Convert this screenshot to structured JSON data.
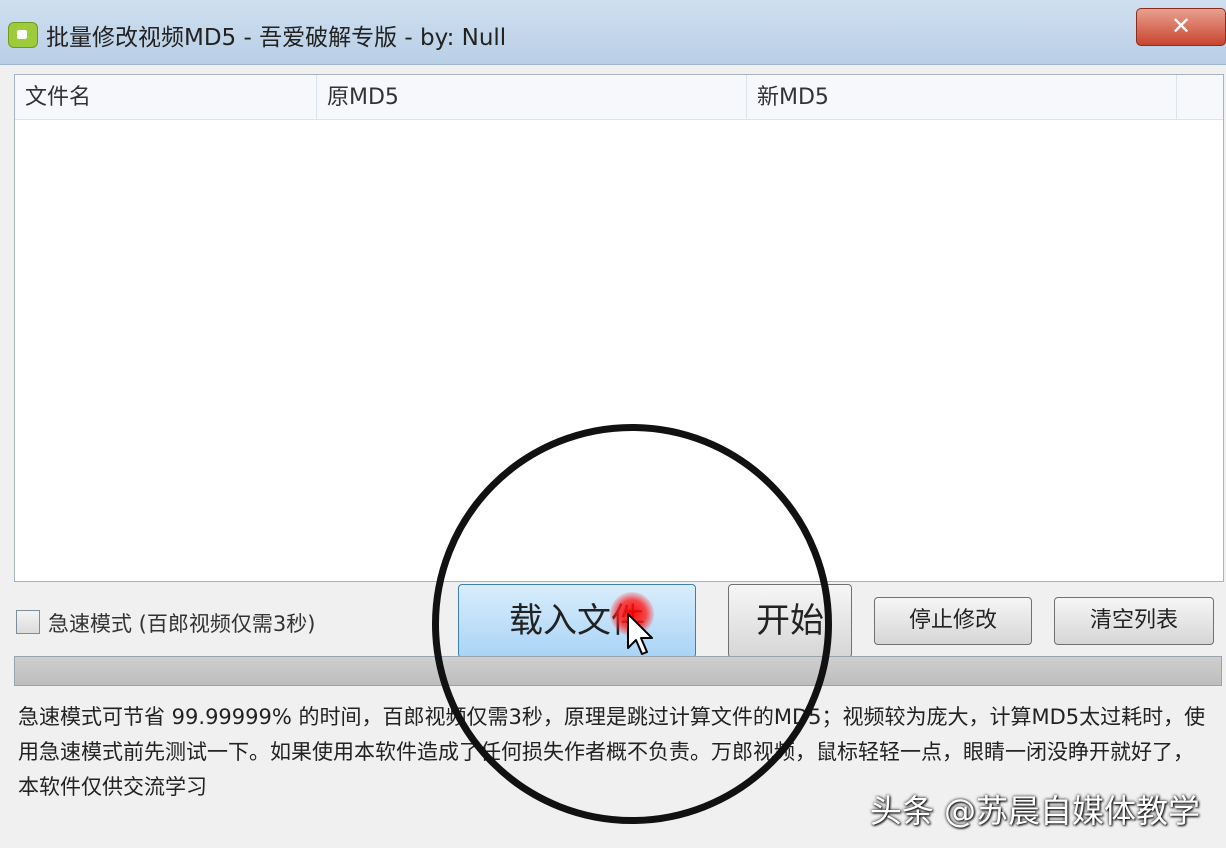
{
  "window": {
    "title": "批量修改视频MD5 - 吾爱破解专版 - by: Null",
    "close_label": "✕"
  },
  "list": {
    "columns": [
      "文件名",
      "原MD5",
      "新MD5"
    ],
    "rows": []
  },
  "options": {
    "fast_mode_label": "急速模式 (百郎视频仅需3秒)",
    "fast_mode_checked": false
  },
  "buttons": {
    "load": "载入文件",
    "start": "开始",
    "stop": "停止修改",
    "clear": "清空列表"
  },
  "progress": {
    "value": 0
  },
  "info": {
    "text": "急速模式可节省 99.99999% 的时间，百郎视频仅需3秒，原理是跳过计算文件的MD5；视频较为庞大，计算MD5太过耗时，使用急速模式前先测试一下。如果使用本软件造成了任何损失作者概不负责。万郎视频，鼠标轻轻一点，眼睛一闭没睁开就好了，本软件仅供交流学习"
  },
  "watermark": "头条 @苏晨自媒体教学",
  "colors": {
    "accent": "#3c7fb1",
    "close": "#c9452f",
    "progress": "#06b025"
  },
  "icons": {
    "app": "app-icon",
    "cursor": "mouse-pointer-icon",
    "checkbox": "checkbox-icon"
  }
}
